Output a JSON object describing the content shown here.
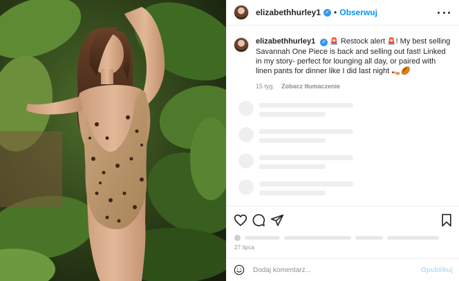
{
  "photo": {
    "alt_icon": "photo-image"
  },
  "header": {
    "username": "elizabethhurley1",
    "verified_icon": "verified-badge-icon",
    "separator": "•",
    "follow_label": "Obserwuj",
    "more_icon": "more-options-icon"
  },
  "caption": {
    "username": "elizabethhurley1",
    "text": "Restock alert",
    "text_rest": "! My best selling Savannah One Piece is back and selling out fast! Linked in my story- perfect for lounging all day, or paired with linen pants for dinner like I did last night",
    "siren_emoji": "🚨",
    "end_emojis": "👡🏉",
    "time_ago": "15 tyg.",
    "translate_label": "Zobacz tłumaczenie"
  },
  "actions": {
    "like_icon": "heart-icon",
    "comment_icon": "comment-icon",
    "share_icon": "share-icon",
    "save_icon": "bookmark-icon"
  },
  "post_date": "27 lipca",
  "comment_box": {
    "emoji_icon": "emoji-icon",
    "placeholder": "Dodaj komentarz...",
    "publish_label": "Opublikuj"
  },
  "colors": {
    "accent": "#0095f6",
    "verified": "#3897f0",
    "muted": "#8e8e8e",
    "publish_disabled": "#b2dffc"
  }
}
